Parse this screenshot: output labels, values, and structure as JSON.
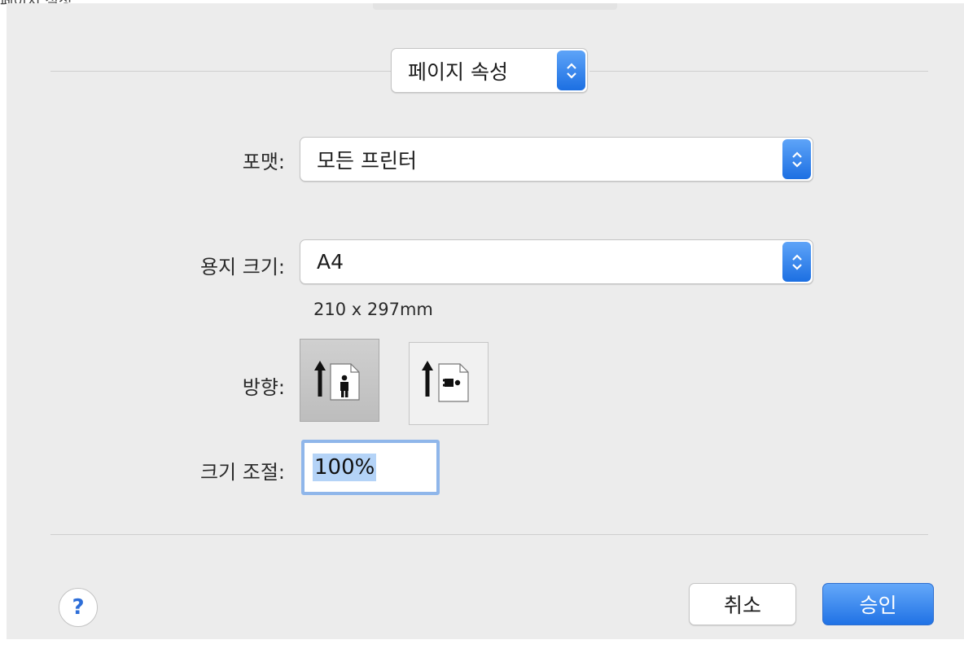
{
  "window": {
    "partial_title": "페이지 설정"
  },
  "panel_selector": {
    "value": "페이지 속성"
  },
  "format": {
    "label": "포맷:",
    "value": "모든 프린터"
  },
  "paper_size": {
    "label": "용지 크기:",
    "value": "A4",
    "dimensions": "210 x 297mm"
  },
  "orientation": {
    "label": "방향:",
    "options": [
      {
        "name": "portrait",
        "selected": true
      },
      {
        "name": "landscape",
        "selected": false
      }
    ]
  },
  "scale": {
    "label": "크기 조절:",
    "value": "100%"
  },
  "buttons": {
    "help": "?",
    "cancel": "취소",
    "ok": "승인"
  },
  "colors": {
    "accent": "#2072e5",
    "selection": "#b4d3f7",
    "focus_ring": "#8fb6ea"
  }
}
